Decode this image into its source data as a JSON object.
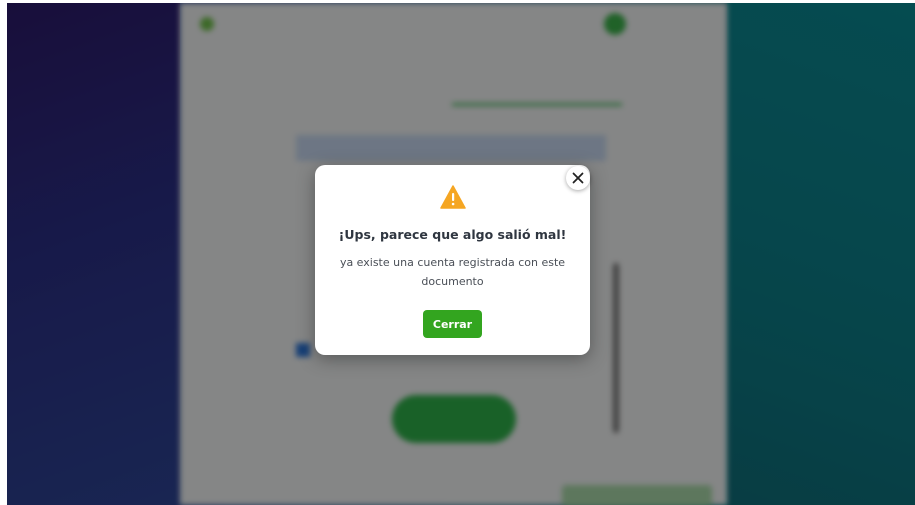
{
  "background": {
    "tabs": [
      "",
      ""
    ]
  },
  "dialog": {
    "title": "¡Ups, parece que algo salió mal!",
    "message": "ya existe una cuenta registrada con este documento",
    "primary_button": "Cerrar",
    "icon": "warning-icon",
    "close_icon": "close-icon",
    "accent_color": "#33a51f",
    "warning_color": "#f5a623"
  }
}
